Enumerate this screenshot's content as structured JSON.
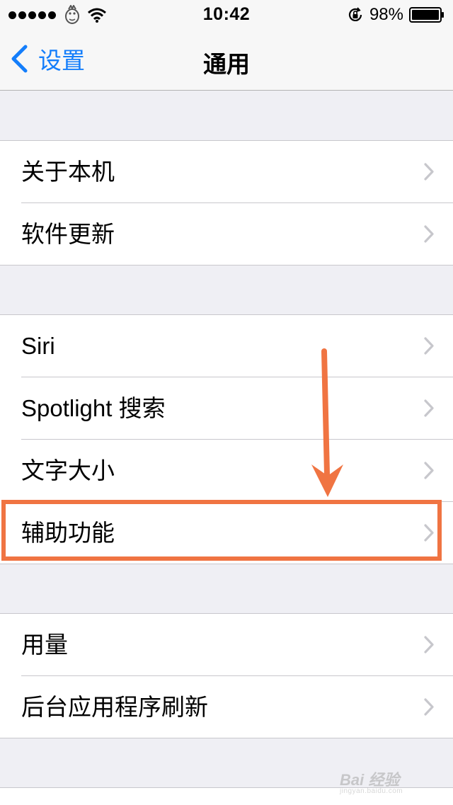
{
  "status_bar": {
    "time": "10:42",
    "battery_percent": "98%",
    "signal_bars": 5,
    "icons": [
      "signal-dots",
      "carrier-mascot-icon",
      "wifi-icon",
      "rotation-lock-icon",
      "battery-icon"
    ]
  },
  "nav": {
    "back_label": "设置",
    "title": "通用",
    "accent_color": "#147efb"
  },
  "groups": [
    {
      "items": [
        {
          "label": "关于本机"
        },
        {
          "label": "软件更新"
        }
      ]
    },
    {
      "items": [
        {
          "label": "Siri"
        },
        {
          "label": "Spotlight 搜索"
        },
        {
          "label": "文字大小"
        },
        {
          "label": "辅助功能",
          "highlighted": true
        }
      ]
    },
    {
      "items": [
        {
          "label": "用量"
        },
        {
          "label": "后台应用程序刷新"
        }
      ]
    }
  ],
  "annotation": {
    "color": "#f07442",
    "type": "arrow-and-box",
    "target_label": "辅助功能"
  },
  "watermark": {
    "brand": "Bai 经验",
    "sub": "jingyan.baidu.com"
  }
}
